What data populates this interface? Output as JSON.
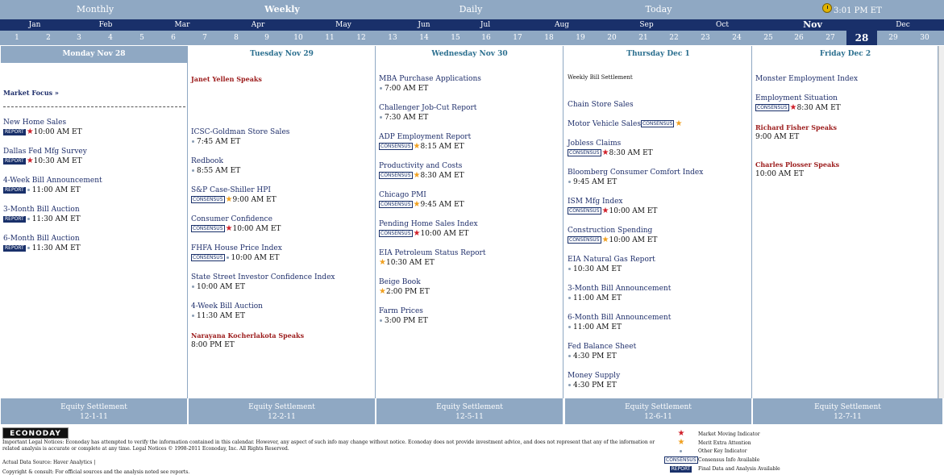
{
  "view_tabs": [
    {
      "label": "Monthly",
      "active": false
    },
    {
      "label": "Weekly",
      "active": true
    },
    {
      "label": "Daily",
      "active": false
    },
    {
      "label": "Today",
      "active": false
    }
  ],
  "clock_time": "3:01 PM ET",
  "months": [
    "Jan",
    "Feb",
    "Mar",
    "Apr",
    "May",
    "Jun",
    "Jul",
    "Aug",
    "Sep",
    "Oct",
    "Nov",
    "Dec"
  ],
  "current_month": "Nov",
  "days": [
    "1",
    "2",
    "3",
    "4",
    "5",
    "6",
    "7",
    "8",
    "9",
    "10",
    "11",
    "12",
    "13",
    "14",
    "15",
    "16",
    "17",
    "18",
    "19",
    "20",
    "21",
    "22",
    "23",
    "24",
    "25",
    "26",
    "27",
    "28",
    "29",
    "30"
  ],
  "selected_day": "28",
  "market_focus": "Market Focus »",
  "monday": {
    "header": "Monday Nov 28",
    "events": [
      {
        "name": "New Home Sales",
        "badge": "REPORT",
        "marker": "red",
        "time": "10:00 AM ET"
      },
      {
        "name": "Dallas Fed Mfg Survey",
        "badge": "REPORT",
        "marker": "red",
        "time": "10:30 AM ET"
      },
      {
        "name": "4-Week Bill Announcement",
        "badge": "REPORT",
        "marker": "dot",
        "time": "11:00 AM ET"
      },
      {
        "name": "3-Month Bill Auction",
        "badge": "REPORT",
        "marker": "dot",
        "time": "11:30 AM ET"
      },
      {
        "name": "6-Month Bill Auction",
        "badge": "REPORT",
        "marker": "dot",
        "time": "11:30 AM ET"
      }
    ]
  },
  "tuesday": {
    "header": "Tuesday Nov 29",
    "speaker_top": "Janet Yellen Speaks",
    "events": [
      {
        "name": "ICSC-Goldman Store Sales",
        "badge": "",
        "marker": "dot",
        "time": "7:45 AM ET"
      },
      {
        "name": "Redbook",
        "badge": "",
        "marker": "dot",
        "time": "8:55 AM ET"
      },
      {
        "name": "S&P Case-Shiller HPI",
        "badge": "CONSENSUS",
        "marker": "gold",
        "time": "9:00 AM ET"
      },
      {
        "name": "Consumer Confidence",
        "badge": "CONSENSUS",
        "marker": "red",
        "time": "10:00 AM ET"
      },
      {
        "name": "FHFA House Price Index",
        "badge": "CONSENSUS",
        "marker": "dot",
        "time": "10:00 AM ET"
      },
      {
        "name": "State Street Investor Confidence Index",
        "badge": "",
        "marker": "dot",
        "time": "10:00 AM ET"
      },
      {
        "name": "4-Week Bill Auction",
        "badge": "",
        "marker": "dot",
        "time": "11:30 AM ET"
      }
    ],
    "speaker_bottom": "Narayana Kocherlakota Speaks",
    "speaker_bottom_time": "8:00 PM ET"
  },
  "wednesday": {
    "header": "Wednesday Nov 30",
    "events": [
      {
        "name": "MBA Purchase Applications",
        "badge": "",
        "marker": "dot",
        "time": "7:00 AM ET"
      },
      {
        "name": "Challenger Job-Cut Report",
        "badge": "",
        "marker": "dot",
        "time": "7:30 AM ET"
      },
      {
        "name": "ADP Employment Report",
        "badge": "CONSENSUS",
        "marker": "gold",
        "time": "8:15 AM ET"
      },
      {
        "name": "Productivity and Costs",
        "badge": "CONSENSUS",
        "marker": "gold",
        "time": "8:30 AM ET"
      },
      {
        "name": "Chicago PMI",
        "badge": "CONSENSUS",
        "marker": "gold",
        "time": "9:45 AM ET"
      },
      {
        "name": "Pending Home Sales Index",
        "badge": "CONSENSUS",
        "marker": "red",
        "time": "10:00 AM ET"
      },
      {
        "name": "EIA Petroleum Status Report",
        "badge": "",
        "marker": "gold",
        "time": "10:30 AM ET"
      },
      {
        "name": "Beige Book",
        "badge": "",
        "marker": "gold",
        "time": "2:00 PM ET"
      },
      {
        "name": "Farm Prices",
        "badge": "",
        "marker": "dot",
        "time": "3:00 PM ET"
      }
    ]
  },
  "thursday": {
    "header": "Thursday Dec 1",
    "note": "Weekly Bill Settlement",
    "events": [
      {
        "name": "Chain Store Sales",
        "badge": "",
        "marker": "",
        "time": ""
      },
      {
        "name": "Motor Vehicle Sales",
        "badge": "CONSENSUS",
        "marker": "gold",
        "time": "",
        "inline": true
      },
      {
        "name": "Jobless Claims",
        "badge": "CONSENSUS",
        "marker": "red",
        "time": "8:30 AM ET"
      },
      {
        "name": "Bloomberg Consumer Comfort Index",
        "badge": "",
        "marker": "dot",
        "time": "9:45 AM ET"
      },
      {
        "name": "ISM Mfg Index",
        "badge": "CONSENSUS",
        "marker": "red",
        "time": "10:00 AM ET"
      },
      {
        "name": "Construction Spending",
        "badge": "CONSENSUS",
        "marker": "gold",
        "time": "10:00 AM ET"
      },
      {
        "name": "EIA Natural Gas Report",
        "badge": "",
        "marker": "dot",
        "time": "10:30 AM ET"
      },
      {
        "name": "3-Month Bill Announcement",
        "badge": "",
        "marker": "dot",
        "time": "11:00 AM ET"
      },
      {
        "name": "6-Month Bill Announcement",
        "badge": "",
        "marker": "dot",
        "time": "11:00 AM ET"
      },
      {
        "name": "Fed Balance Sheet",
        "badge": "",
        "marker": "dot",
        "time": "4:30 PM ET"
      },
      {
        "name": "Money Supply",
        "badge": "",
        "marker": "dot",
        "time": "4:30 PM ET"
      }
    ]
  },
  "friday": {
    "header": "Friday Dec 2",
    "events": [
      {
        "name": "Monster Employment Index",
        "badge": "",
        "marker": "",
        "time": ""
      },
      {
        "name": "Employment Situation",
        "badge": "CONSENSUS",
        "marker": "red",
        "time": "8:30 AM ET"
      }
    ],
    "speaker1": "Richard Fisher Speaks",
    "speaker1_time": "9:00 AM ET",
    "speaker2": "Charles Plosser Speaks",
    "speaker2_time": "10:00 AM ET"
  },
  "settlements": [
    {
      "label": "Equity Settlement",
      "date": "12-1-11"
    },
    {
      "label": "Equity Settlement",
      "date": "12-2-11"
    },
    {
      "label": "Equity Settlement",
      "date": "12-5-11"
    },
    {
      "label": "Equity Settlement",
      "date": "12-6-11"
    },
    {
      "label": "Equity Settlement",
      "date": "12-7-11"
    }
  ],
  "logo": "ECONODAY",
  "legal_text": "Important Legal Notices: Econoday has attempted to verify the information contained in this calendar. However, any aspect of such info may change without notice. Econoday does not provide investment advice, and does not represent that any of the information or related analysis is accurate or complete at any time.  Legal Notices © 1998-2011 Econoday, Inc. All Rights Reserved.",
  "source_text": "Actual Data Source: Haver Analytics |",
  "source_more": "Copyright & consult: For official sources and the analysis noted see reports.",
  "legend": [
    {
      "symbol": "red",
      "label": "Market Moving Indicator"
    },
    {
      "symbol": "gold",
      "label": "Merit Extra Attention"
    },
    {
      "symbol": "dot",
      "label": "Other Key Indicator"
    },
    {
      "symbol": "CONSENSUS",
      "label": "Consensus Info Available"
    },
    {
      "symbol": "REPORT",
      "label": "Final Data and Analysis Available"
    }
  ],
  "colors": {
    "navy": "#19306a",
    "steel": "#8fa8c3",
    "red": "#d0202a",
    "gold": "#f0a020"
  }
}
